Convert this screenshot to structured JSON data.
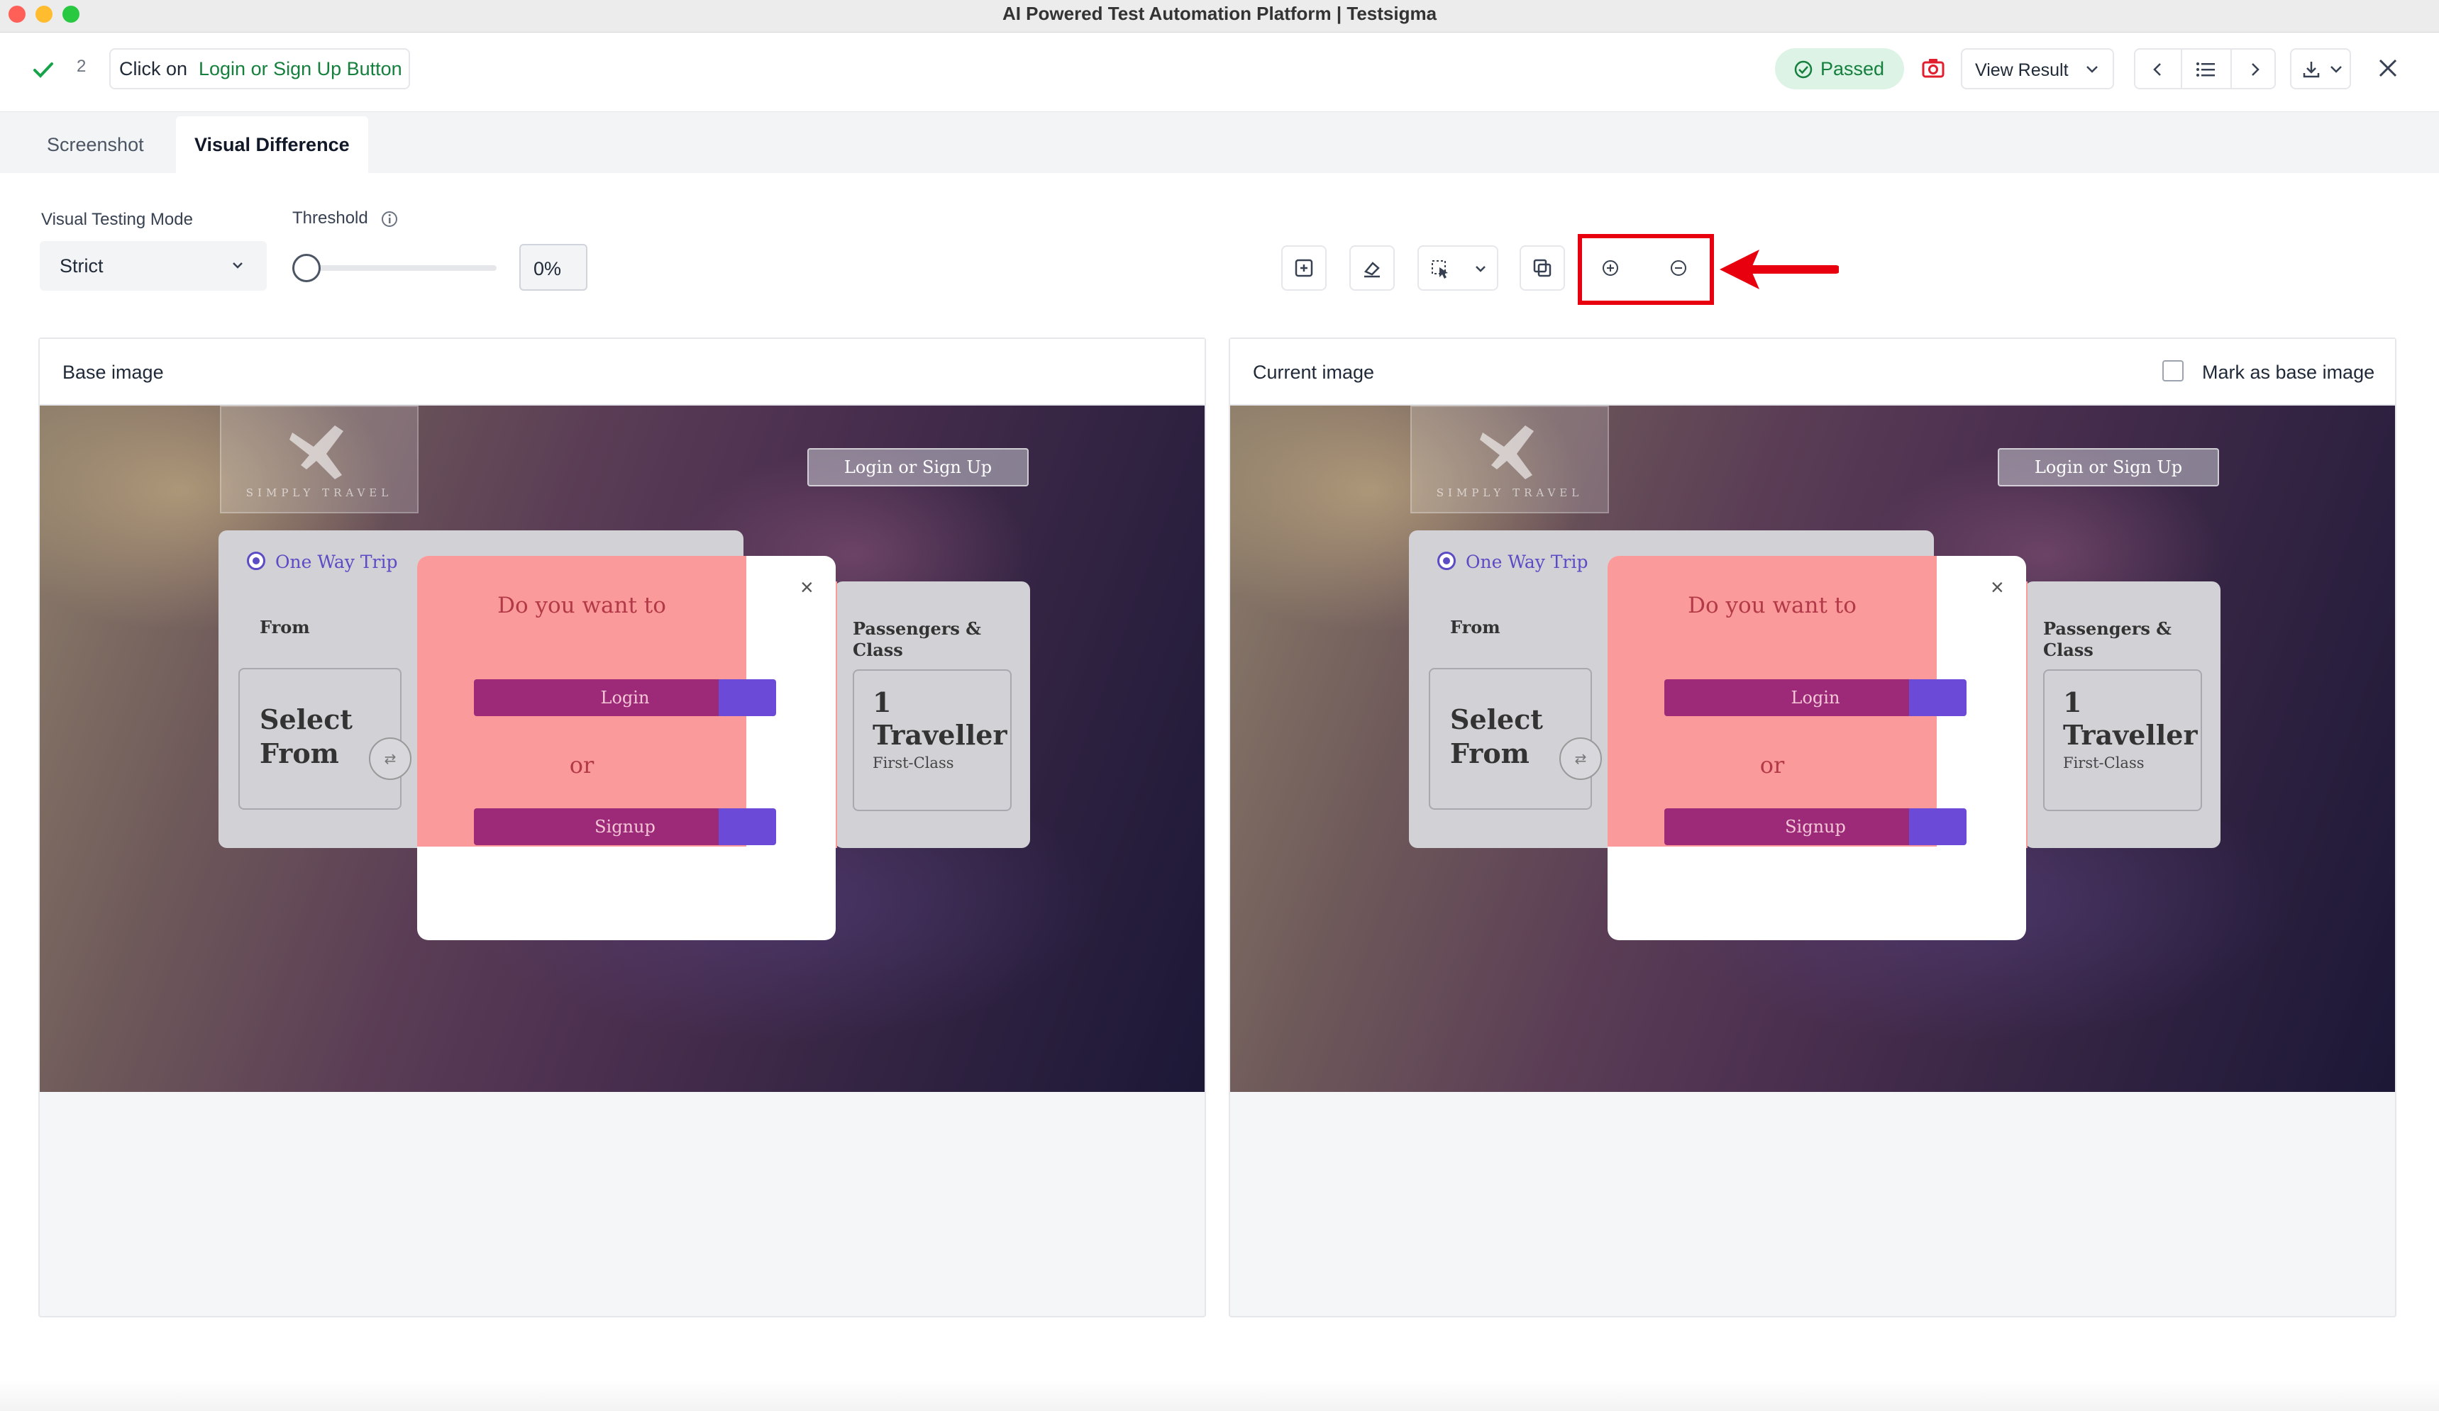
{
  "window": {
    "title": "AI Powered Test Automation Platform | Testsigma"
  },
  "step": {
    "number": "2",
    "action": "Click on",
    "target": "Login or Sign Up Button"
  },
  "status": {
    "label": "Passed",
    "color": "#16a34a"
  },
  "toolbar": {
    "view_result_label": "View Result"
  },
  "tabs": [
    {
      "label": "Screenshot",
      "active": false
    },
    {
      "label": "Visual Difference",
      "active": true
    }
  ],
  "controls": {
    "mode_label": "Visual Testing Mode",
    "mode_value": "Strict",
    "threshold_label": "Threshold",
    "threshold_value": "0%",
    "threshold_fraction": 0
  },
  "panels": {
    "base_label": "Base image",
    "current_label": "Current image",
    "mark_base_label": "Mark as base image"
  },
  "app_preview": {
    "brand": "SIMPLY TRAVEL",
    "login_signup": "Login or Sign Up",
    "trip_option": "One Way Trip",
    "from_label": "From",
    "select_from_line1": "Select",
    "select_from_line2": "From",
    "passengers_line1": "Passengers &",
    "passengers_line2": "Class",
    "traveller_count": "1",
    "traveller_word": "Traveller",
    "traveller_class": "First-Class",
    "modal_question": "Do you want to",
    "modal_login": "Login",
    "modal_or": "or",
    "modal_signup": "Signup"
  },
  "colors": {
    "accent": "#15803d",
    "highlight": "#e8000f",
    "diff_overlay": "#fb9a9a"
  }
}
